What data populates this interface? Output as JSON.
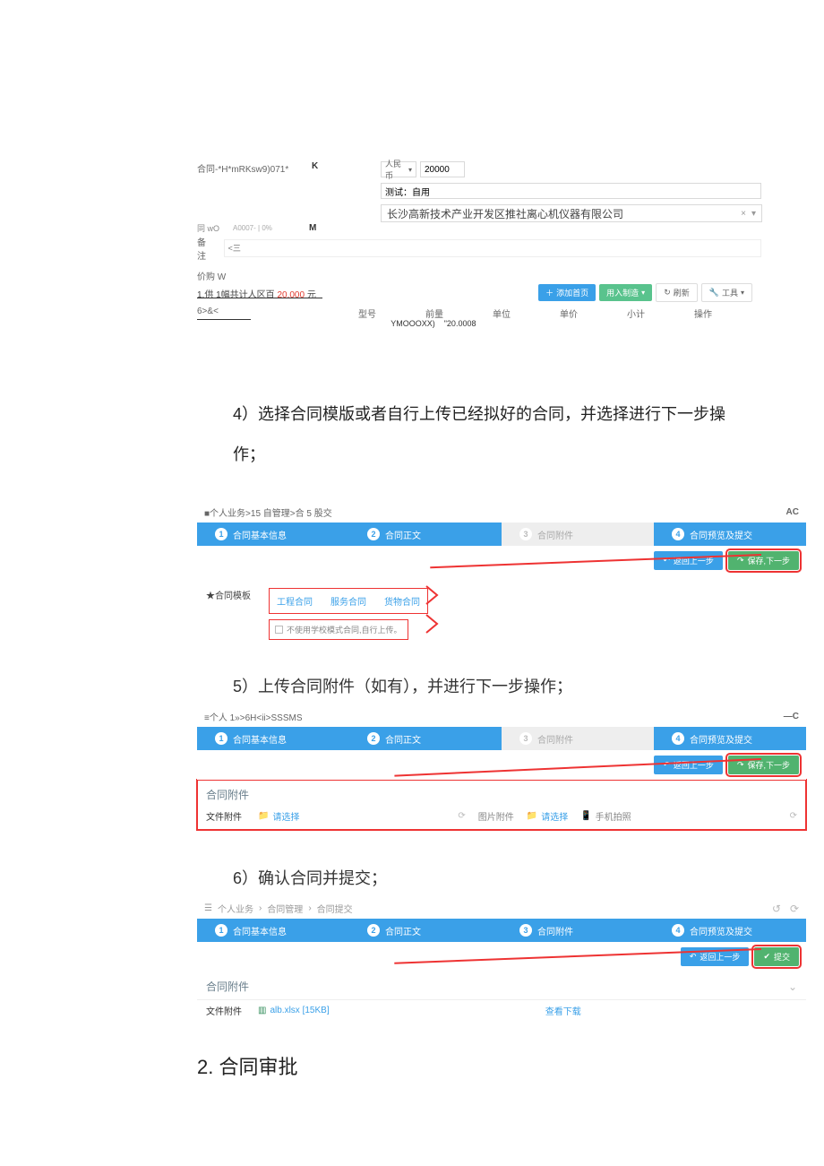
{
  "section1": {
    "contract_label": "合同-*H*mRKsw9)071*",
    "k_label": "K",
    "currency_label": "人民币",
    "amount_value": "20000",
    "test_field": "测试：自用",
    "seller_name": "长沙高新技术产业开发区推社离心机仪器有限公司",
    "mid_lbl1": "同 wO",
    "mid_lbl2": "A0007- | 0%",
    "mid_lbl3": "M",
    "note_lbl": "备注",
    "note_placeholder": "<三",
    "supply_title": "价购 W",
    "total_line_pre": "1.供 1幅共计人区百 ",
    "total_line_amt": "20.000",
    "total_line_suf": " 元",
    "btn_add": "添加首页",
    "btn_import": "用入制造",
    "btn_refresh": "刷新",
    "btn_tool": "工具",
    "gh": {
      "c1": "6>&<",
      "c2": "型号",
      "c3": "前量",
      "c4": "单位",
      "c5": "单价",
      "c6": "小计",
      "c7": "操作"
    },
    "sub": {
      "c3": "YMOOOXX)",
      "c4": "\"20.0008"
    }
  },
  "instr4": "4）选择合同模版或者自行上传已经拟好的合同，并选择进行下一步操作；",
  "step4": {
    "breadcrumb": "■个人业务>15 自管理>合 5 股交",
    "bc_right": "AC",
    "seg1": "合同基本信息",
    "seg2": "合同正文",
    "seg3": "合同附件",
    "seg4": "合同预览及提交",
    "btn_prev": "返回上一步",
    "btn_next": "保存,下一步",
    "tpl_label": "★合同模板",
    "tpl_opt1": "工程合同",
    "tpl_opt2": "服务合同",
    "tpl_opt3": "货物合同",
    "tpl_self": "不使用学校模式合同,自行上传。"
  },
  "instr5": "5）上传合同附件（如有），并进行下一步操作；",
  "step5": {
    "breadcrumb": "≡个人 1»>6H<ii>SSSMS",
    "bc_right": "—C",
    "seg1": "合同基本信息",
    "seg2": "合同正文",
    "seg3": "合同附件",
    "seg4": "合同预览及提交",
    "btn_prev": "返回上一步",
    "btn_next": "保存,下一步",
    "attach_hd": "合同附件",
    "lbl_file": "文件附件",
    "lnk_choose": "请选择",
    "lbl_img": "图片附件",
    "lnk_choose2": "请选择",
    "lnk_phone": "手机拍照"
  },
  "instr6": "6）确认合同并提交；",
  "step6": {
    "breadcrumb_l1": "个人业务",
    "breadcrumb_l2": "合同管理",
    "breadcrumb_l3": "合同提交",
    "seg1": "合同基本信息",
    "seg2": "合同正文",
    "seg3": "合同附件",
    "seg4": "合同预览及提交",
    "btn_prev": "返回上一步",
    "btn_submit": "提交",
    "attach_hd": "合同附件",
    "lbl_file": "文件附件",
    "file_name": "alb.xlsx [15KB]",
    "dl": "查看下载"
  },
  "h2": "2. 合同审批"
}
